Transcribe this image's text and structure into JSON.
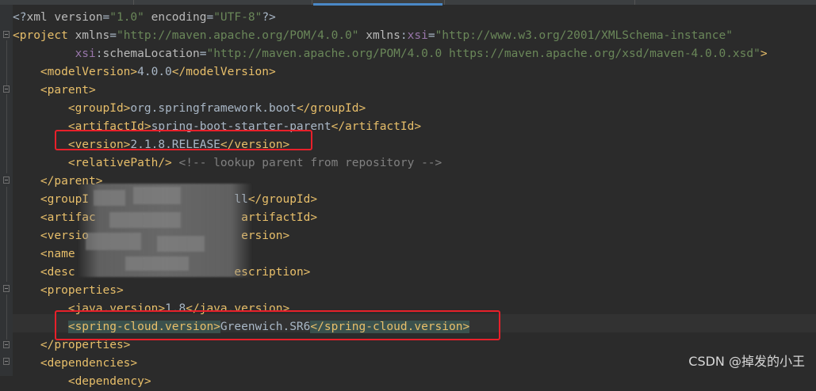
{
  "lines": [
    [
      {
        "c": "tx",
        "s": "<?"
      },
      {
        "c": "ta",
        "s": "xml version"
      },
      {
        "c": "tx",
        "s": "="
      },
      {
        "c": "tv",
        "s": "\"1.0\""
      },
      {
        "c": "ta",
        "s": " encoding"
      },
      {
        "c": "tx",
        "s": "="
      },
      {
        "c": "tv",
        "s": "\"UTF-8\""
      },
      {
        "c": "tx",
        "s": "?>"
      }
    ],
    [
      {
        "c": "t",
        "s": "<project "
      },
      {
        "c": "ta",
        "s": "xmlns"
      },
      {
        "c": "tx",
        "s": "="
      },
      {
        "c": "tv",
        "s": "\"http://maven.apache.org/POM/4.0.0\""
      },
      {
        "c": "ta",
        "s": " xmlns"
      },
      {
        "c": "tx",
        "s": ":"
      },
      {
        "c": "tns",
        "s": "xsi"
      },
      {
        "c": "tx",
        "s": "="
      },
      {
        "c": "tv",
        "s": "\"http://www.w3.org/2001/XMLSchema-instance\""
      }
    ],
    [
      {
        "c": "tx",
        "s": "         "
      },
      {
        "c": "tns",
        "s": "xsi"
      },
      {
        "c": "tx",
        "s": ":"
      },
      {
        "c": "ta",
        "s": "schemaLocation"
      },
      {
        "c": "tx",
        "s": "="
      },
      {
        "c": "tv",
        "s": "\"http://maven.apache.org/POM/4.0.0 https://maven.apache.org/xsd/maven-4.0.0.xsd\""
      },
      {
        "c": "t",
        "s": ">"
      }
    ],
    [
      {
        "c": "tx",
        "s": "    "
      },
      {
        "c": "t",
        "s": "<modelVersion>"
      },
      {
        "c": "tx",
        "s": "4.0.0"
      },
      {
        "c": "t",
        "s": "</modelVersion>"
      }
    ],
    [
      {
        "c": "tx",
        "s": "    "
      },
      {
        "c": "t",
        "s": "<parent>"
      }
    ],
    [
      {
        "c": "tx",
        "s": "        "
      },
      {
        "c": "t",
        "s": "<groupId>"
      },
      {
        "c": "tx",
        "s": "org.springframework.boot"
      },
      {
        "c": "t",
        "s": "</groupId>"
      }
    ],
    [
      {
        "c": "tx",
        "s": "        "
      },
      {
        "c": "t",
        "s": "<artifactId>"
      },
      {
        "c": "tx",
        "s": "spring-boot-starter-parent"
      },
      {
        "c": "t",
        "s": "</artifactId>"
      }
    ],
    [
      {
        "c": "tx",
        "s": "        "
      },
      {
        "c": "t",
        "s": "<version>"
      },
      {
        "c": "tx",
        "s": "2.1.8.RELEASE"
      },
      {
        "c": "t",
        "s": "</version>"
      }
    ],
    [
      {
        "c": "tx",
        "s": "        "
      },
      {
        "c": "t",
        "s": "<relativePath/>"
      },
      {
        "c": "tc",
        "s": " <!-- lookup parent from repository -->"
      }
    ],
    [
      {
        "c": "tx",
        "s": "    "
      },
      {
        "c": "t",
        "s": "</parent>"
      }
    ],
    [
      {
        "c": "tx",
        "s": "    "
      },
      {
        "c": "t",
        "s": "<groupI"
      },
      {
        "c": "tx",
        "s": "                     ll"
      },
      {
        "c": "t",
        "s": "</groupId>"
      }
    ],
    [
      {
        "c": "tx",
        "s": "    "
      },
      {
        "c": "t",
        "s": "<artifac"
      },
      {
        "c": "tx",
        "s": "                     "
      },
      {
        "c": "t",
        "s": "artifactId>"
      }
    ],
    [
      {
        "c": "tx",
        "s": "    "
      },
      {
        "c": "t",
        "s": "<versio"
      },
      {
        "c": "tx",
        "s": "                      "
      },
      {
        "c": "t",
        "s": "ersion>"
      }
    ],
    [
      {
        "c": "tx",
        "s": "    "
      },
      {
        "c": "t",
        "s": "<name"
      }
    ],
    [
      {
        "c": "tx",
        "s": "    "
      },
      {
        "c": "t",
        "s": "<desc"
      },
      {
        "c": "tx",
        "s": "                       "
      },
      {
        "c": "t",
        "s": "escription>"
      }
    ],
    [
      {
        "c": "tx",
        "s": "    "
      },
      {
        "c": "t",
        "s": "<properties>"
      }
    ],
    [
      {
        "c": "tx",
        "s": "        "
      },
      {
        "c": "t",
        "s": "<java.version>"
      },
      {
        "c": "tx",
        "s": "1.8"
      },
      {
        "c": "t",
        "s": "</java.version>"
      }
    ],
    [
      {
        "c": "tx",
        "s": "        "
      },
      {
        "c": "t match",
        "s": "<spring-cloud.version>"
      },
      {
        "c": "tx",
        "s": "Greenwich.SR6"
      },
      {
        "c": "t match",
        "s": "</spring-cloud.version>"
      }
    ],
    [
      {
        "c": "tx",
        "s": "    "
      },
      {
        "c": "t",
        "s": "</properties>"
      }
    ],
    [
      {
        "c": "tx",
        "s": "    "
      },
      {
        "c": "t",
        "s": "<dependencies>"
      }
    ],
    [
      {
        "c": "tx",
        "s": "        "
      },
      {
        "c": "t",
        "s": "<dependency>"
      }
    ]
  ],
  "watermark": "CSDN @掉发的小王",
  "colors": {
    "tag": "#e8bf6a",
    "attr": "#bababa",
    "value": "#6a8759",
    "text": "#a9b7c6",
    "comment": "#808080",
    "highlight": "#e8202a"
  }
}
